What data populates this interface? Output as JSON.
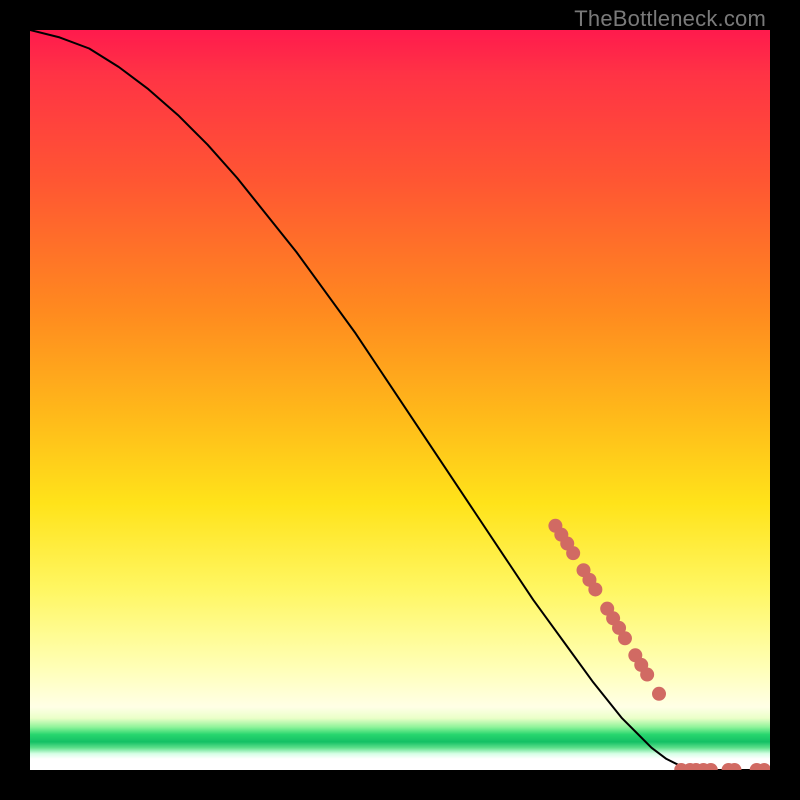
{
  "watermark": "TheBottleneck.com",
  "chart_data": {
    "type": "line",
    "title": "",
    "xlabel": "",
    "ylabel": "",
    "xlim": [
      0,
      100
    ],
    "ylim": [
      0,
      100
    ],
    "grid": false,
    "legend": false,
    "series": [
      {
        "name": "bottleneck-curve",
        "x": [
          0,
          4,
          8,
          12,
          16,
          20,
          24,
          28,
          32,
          36,
          40,
          44,
          48,
          52,
          56,
          60,
          64,
          68,
          72,
          76,
          80,
          84,
          86,
          88,
          90,
          92,
          94,
          96,
          98,
          100
        ],
        "y": [
          100,
          99,
          97.5,
          95,
          92,
          88.5,
          84.5,
          80,
          75,
          70,
          64.5,
          59,
          53,
          47,
          41,
          35,
          29,
          23,
          17.5,
          12,
          7,
          3,
          1.5,
          0.5,
          0,
          0,
          0,
          0,
          0,
          0
        ]
      }
    ],
    "markers": [
      {
        "name": "segment-dots",
        "color": "#d16a63",
        "points": [
          {
            "x": 71.0,
            "y": 33.0
          },
          {
            "x": 71.8,
            "y": 31.8
          },
          {
            "x": 72.6,
            "y": 30.6
          },
          {
            "x": 73.4,
            "y": 29.3
          },
          {
            "x": 74.8,
            "y": 27.0
          },
          {
            "x": 75.6,
            "y": 25.7
          },
          {
            "x": 76.4,
            "y": 24.4
          },
          {
            "x": 78.0,
            "y": 21.8
          },
          {
            "x": 78.8,
            "y": 20.5
          },
          {
            "x": 79.6,
            "y": 19.2
          },
          {
            "x": 80.4,
            "y": 17.8
          },
          {
            "x": 81.8,
            "y": 15.5
          },
          {
            "x": 82.6,
            "y": 14.2
          },
          {
            "x": 83.4,
            "y": 12.9
          },
          {
            "x": 85.0,
            "y": 10.3
          },
          {
            "x": 88.0,
            "y": 0.0
          },
          {
            "x": 89.2,
            "y": 0.0
          },
          {
            "x": 90.0,
            "y": 0.0
          },
          {
            "x": 91.0,
            "y": 0.0
          },
          {
            "x": 92.0,
            "y": 0.0
          },
          {
            "x": 94.4,
            "y": 0.0
          },
          {
            "x": 95.2,
            "y": 0.0
          },
          {
            "x": 98.2,
            "y": 0.0
          },
          {
            "x": 99.2,
            "y": 0.0
          }
        ]
      }
    ],
    "background_gradient": {
      "orientation": "vertical",
      "stops": [
        {
          "pos": 0.0,
          "color": "#ff1a4d"
        },
        {
          "pos": 0.5,
          "color": "#ffc61a"
        },
        {
          "pos": 0.88,
          "color": "#ffffcc"
        },
        {
          "pos": 0.955,
          "color": "#20cf6a"
        },
        {
          "pos": 1.0,
          "color": "#ffffff"
        }
      ]
    }
  }
}
